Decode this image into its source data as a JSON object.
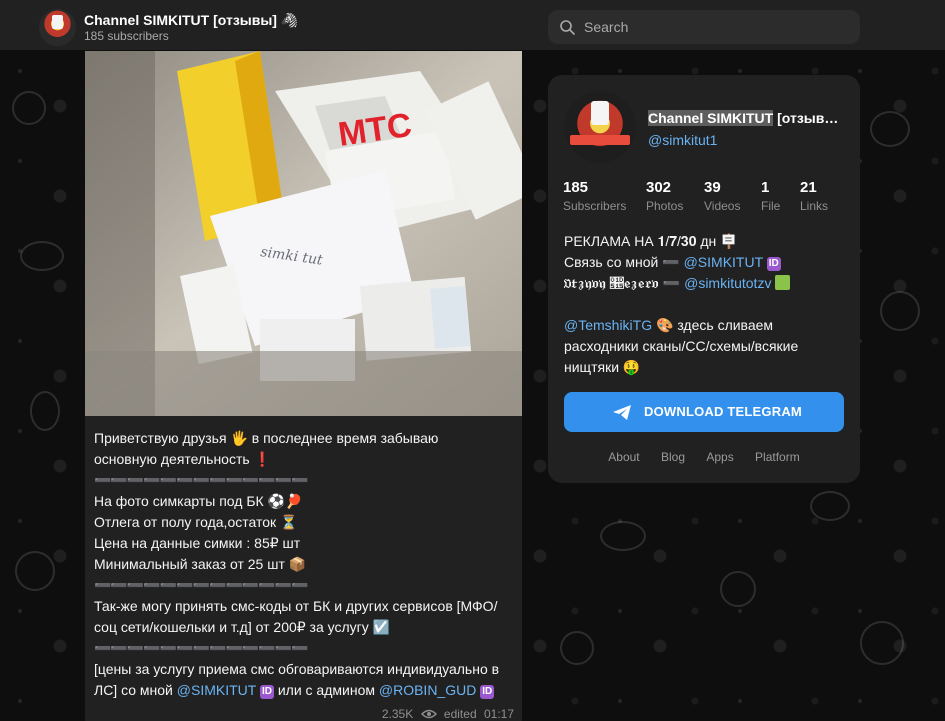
{
  "header": {
    "title": "Channel SIMKITUT [отзывы] 🦓",
    "subtitle": "185 subscribers",
    "search_placeholder": "Search"
  },
  "message": {
    "lines": [
      "Приветствую друзья 🖐 в последнее время забываю",
      "основную деятельность ❗",
      "➖➖➖➖➖➖➖➖➖➖➖➖➖",
      "На фото симкарты под БК ⚽🏓",
      "Отлега от полу года,остаток ⏳",
      "Цена на данные симки : 85₽ шт",
      "Минимальный заказ от 25 шт 📦",
      "➖➖➖➖➖➖➖➖➖➖➖➖➖",
      "Так-же могу принять смс-коды от БК и других сервисов [МФО/",
      "соц сети/кошельки и т.д] от 200₽ за услугу ☑️",
      "➖➖➖➖➖➖➖➖➖➖➖➖➖",
      "[цены за услугу приема смс обговариваются индивидуально в"
    ],
    "last_line_prefix": "ЛС] со мной ",
    "last_line_link1": "@SIMKITUT",
    "last_line_middle": " или с админом ",
    "last_line_link2": "@ROBIN_GUD",
    "id_badge": "ID",
    "views": "2.35K",
    "edited": "edited",
    "time": "01:17"
  },
  "panel": {
    "title_highlight": "Channel SIMKITUT",
    "title_rest": " [отзывы] 🦓",
    "handle": "@simkitut1",
    "stats": [
      {
        "num": "185",
        "label": "Subscribers"
      },
      {
        "num": "302",
        "label": "Photos"
      },
      {
        "num": "39",
        "label": "Videos"
      },
      {
        "num": "1",
        "label": "File"
      },
      {
        "num": "21",
        "label": "Links"
      }
    ],
    "desc_line1": "РЕКЛАМА НА 𝟏/𝟕/𝟑𝟎 дн 🪧",
    "desc_line2_prefix": "Связь со мной ➖ ",
    "desc_line2_link": "@SIMKITUT",
    "desc_line3_prefix": "𝔒𝔱𝔷𝔶𝔳𝔶 𝔕𝔢𝔷𝔢𝔯𝔳 ➖ ",
    "desc_line3_link": "@simkitutotzv",
    "desc_line4_link": "@TemshikiTG",
    "desc_line4_rest": " 🎨 здесь сливаем",
    "desc_line5": "расходники сканы/CC/схемы/всякие",
    "desc_line6": "нищтяки 🤑",
    "download_label": "DOWNLOAD TELEGRAM",
    "footer": [
      "About",
      "Blog",
      "Apps",
      "Platform"
    ]
  },
  "photo_text": {
    "brand": "МТС",
    "handwriting": "simki tut"
  },
  "colors": {
    "accent": "#3390ec",
    "link": "#6ab3f3",
    "surface": "#212121",
    "badge": "#9b59d0"
  }
}
